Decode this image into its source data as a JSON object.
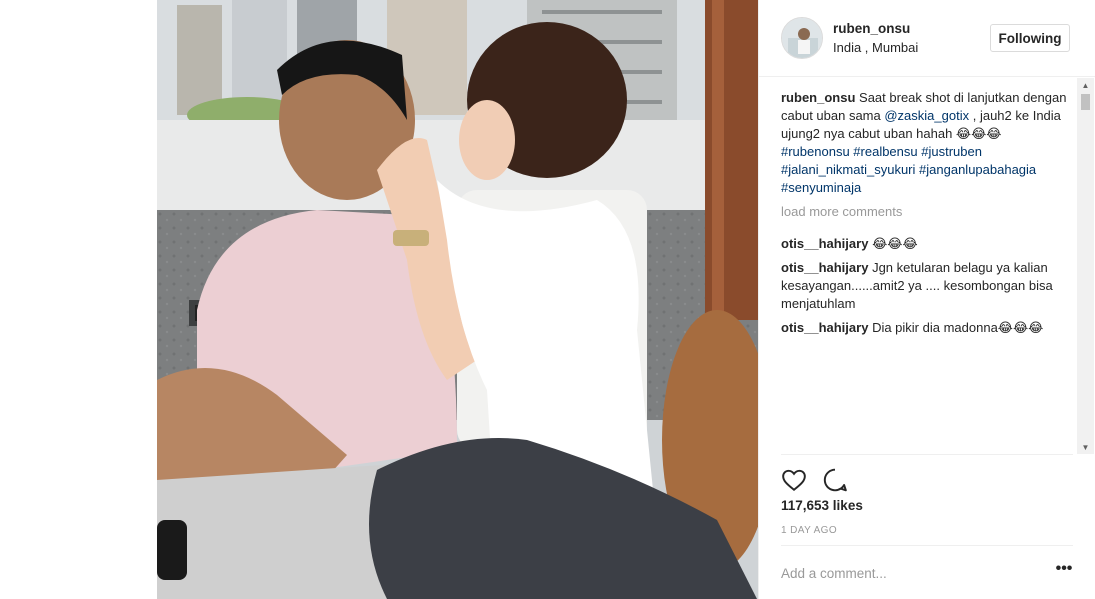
{
  "post": {
    "username": "ruben_onsu",
    "location": "India , Mumbai",
    "follow_label": "Following",
    "caption": {
      "author": "ruben_onsu",
      "text_1": "Saat break shot di lanjutkan dengan cabut uban sama ",
      "mention": "@zaskia_gotix",
      "text_2": " , jauh2 ke India ujung2 nya cabut uban hahah 😂😂😂 ",
      "hashtags": [
        "#rubenonsu",
        "#realbensu",
        "#justruben",
        "#jalani_nikmati_syukuri",
        "#janganlupabahagia",
        "#senyuminaja"
      ]
    },
    "load_more_label": "load more comments",
    "comments": [
      {
        "author": "otis__hahijary",
        "text": "😂😂😂"
      },
      {
        "author": "otis__hahijary",
        "text": "Jgn ketularan belagu ya kalian kesayangan......amit2 ya .... kesombongan bisa menjatuhlam"
      },
      {
        "author": "otis__hahijary",
        "text": "Dia pikir dia madonna😂😂😂"
      }
    ],
    "likes": "117,653 likes",
    "time": "1 DAY AGO",
    "add_comment_placeholder": "Add a comment...",
    "more_label": "•••"
  },
  "icons": {
    "like": "heart-icon",
    "comment": "comment-bubble-icon",
    "more": "ellipsis-icon"
  },
  "colors": {
    "link": "#003569",
    "muted": "#999999",
    "border": "#dbdbdb"
  }
}
